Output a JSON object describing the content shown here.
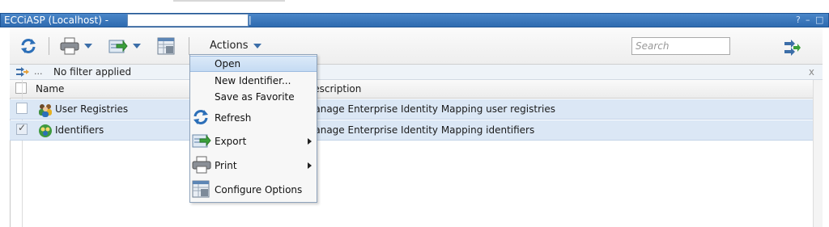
{
  "window": {
    "title": "ECCiASP (Localhost) -",
    "title_mark": "|",
    "controls": [
      "?",
      "–",
      "□"
    ]
  },
  "toolbar": {
    "refresh_icon": "refresh-icon",
    "print_icon": "print-icon",
    "export_icon": "export-icon",
    "configure_icon": "configure-options-icon",
    "actions_label": "Actions",
    "search_placeholder": "Search"
  },
  "filter": {
    "dots": "...",
    "label": "No filter applied",
    "close": "x"
  },
  "grid": {
    "columns": {
      "name": "Name",
      "description": "Description"
    },
    "rows": [
      {
        "name": "User Registries",
        "description": "Manage Enterprise Identity Mapping user registries",
        "checked": false
      },
      {
        "name": "Identifiers",
        "description": "Manage Enterprise Identity Mapping identifiers",
        "checked": true
      }
    ]
  },
  "menu": {
    "items": [
      {
        "label": "Open",
        "highlighted": true
      },
      {
        "label": "New Identifier..."
      },
      {
        "label": "Save as Favorite"
      },
      {
        "label": "Refresh",
        "icon": "refresh-icon"
      },
      {
        "label": "Export",
        "icon": "export-icon",
        "submenu": true
      },
      {
        "label": "Print",
        "icon": "print-icon",
        "submenu": true
      },
      {
        "label": "Configure Options",
        "icon": "configure-options-icon"
      }
    ]
  },
  "colors": {
    "title_bar": "#2f6bb0",
    "row_selected": "#dbe7f5",
    "menu_highlight": "#c5dbf3"
  }
}
